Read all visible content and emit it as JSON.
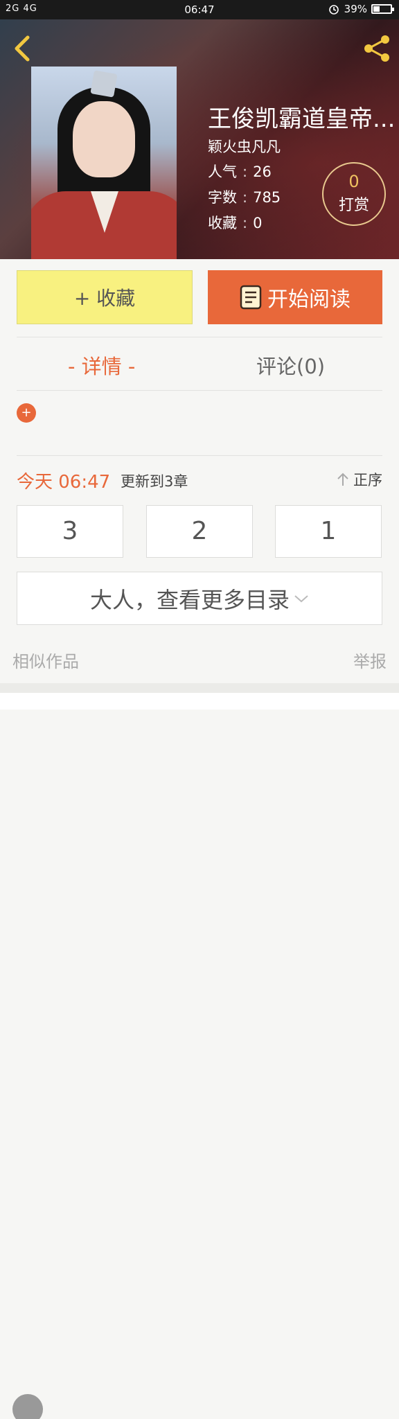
{
  "status_bar": {
    "signal_text": "2G 4G",
    "time": "06:47",
    "battery": "39%",
    "battery_level": 0.39
  },
  "book": {
    "title": "王俊凯霸道皇帝...",
    "author": "颖火虫凡凡",
    "stats": [
      {
        "label": "人气",
        "value": "26"
      },
      {
        "label": "字数",
        "value": "785"
      },
      {
        "label": "收藏",
        "value": "0"
      }
    ],
    "tip": {
      "count": "0",
      "label": "打赏"
    }
  },
  "actions": {
    "favorite": "+ 收藏",
    "start_reading": "开始阅读"
  },
  "tabs": {
    "detail": "- 详情 -",
    "comments": "评论(0)"
  },
  "expand_icon": "+",
  "updates": {
    "today": "今天 06:47",
    "text": "更新到3章",
    "sort": "正序"
  },
  "chapters": [
    "3",
    "2",
    "1"
  ],
  "more_catalog": "大人，查看更多目录",
  "footer": {
    "similar": "相似作品",
    "report": "举报"
  },
  "colors": {
    "accent": "#e8683a",
    "favorite_bg": "#f8f180",
    "tip_number": "#f0c261"
  }
}
